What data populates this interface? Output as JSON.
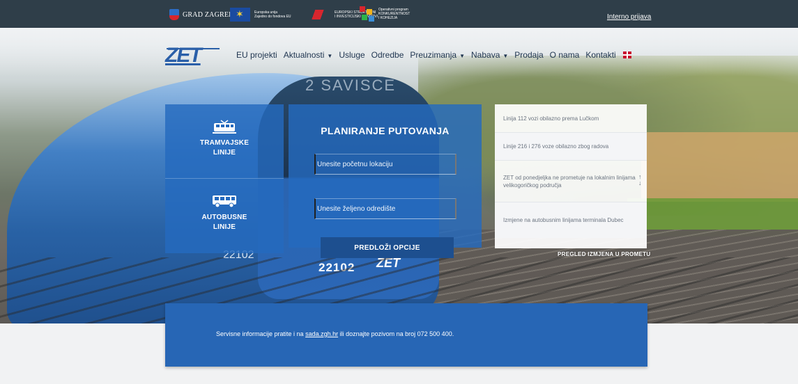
{
  "partners": {
    "grad_zagreb": "GRAD ZAGREB",
    "eu_fund": [
      "Europska unija",
      "Zajedno do fondova EU"
    ],
    "esi_funds": [
      "EUROPSKI STRUKTURNI",
      "I INVESTICIJSKI FONDOVI"
    ],
    "op": [
      "Operativni program",
      "KONKURENTNOST",
      "I KOHEZIJA"
    ]
  },
  "top_link": "Interno prijava",
  "brand": "ZET",
  "nav": [
    {
      "label": "EU projekti",
      "dropdown": false
    },
    {
      "label": "Aktualnosti",
      "dropdown": true
    },
    {
      "label": "Usluge",
      "dropdown": false
    },
    {
      "label": "Odredbe",
      "dropdown": false
    },
    {
      "label": "Preuzimanja",
      "dropdown": true
    },
    {
      "label": "Nabava",
      "dropdown": true
    },
    {
      "label": "Prodaja",
      "dropdown": false
    },
    {
      "label": "O nama",
      "dropdown": false
    },
    {
      "label": "Kontakti",
      "dropdown": false
    }
  ],
  "line_types": {
    "tram": [
      "TRAMVAJSKE",
      "LINIJE"
    ],
    "bus": [
      "AUTOBUSNE",
      "LINIJE"
    ]
  },
  "planner": {
    "title": "PLANIRANJE PUTOVANJA",
    "start_placeholder": "Unesite početnu lokaciju",
    "dest_placeholder": "Unesite željeno odredište",
    "submit": "PREDLOŽI OPCIJE"
  },
  "notices": [
    "Linija 112 vozi obilazno prema Lučkom",
    "Linije 216 i 276 voze obilazno zbog radova",
    "ZET od ponedjeljka ne prometuje na lokalnim linijama velikogoričkog područja",
    "Izmjene na autobusnim linijama terminala Dubec"
  ],
  "changes_link": "PREGLED IZMJENA U PROMETU",
  "tram_photo": {
    "number": "22102",
    "destination": "2 SAVISCE"
  },
  "service": {
    "before": "Servisne informacije pratite i na ",
    "link": "sada.zgh.hr",
    "after": " ili doznajte pozivom na broj 072 500 400."
  },
  "colors": {
    "panel_blue": "#256abe",
    "topbar": "#2f3e49",
    "button_blue": "#1d4f8f"
  }
}
